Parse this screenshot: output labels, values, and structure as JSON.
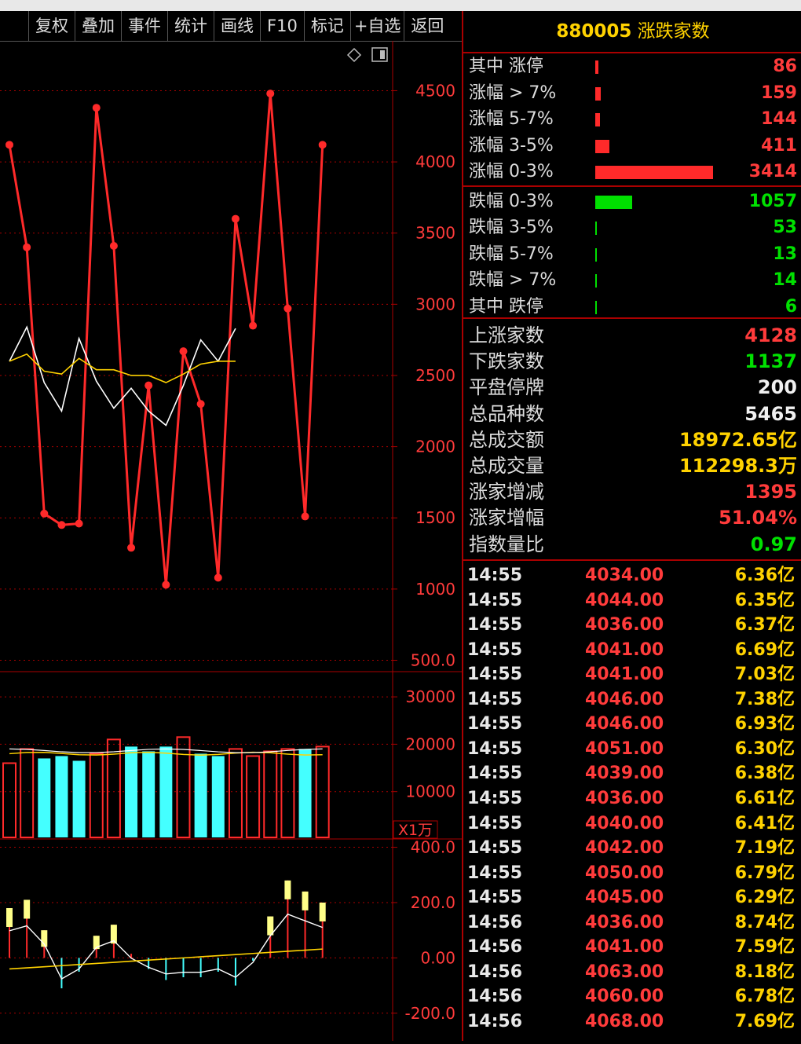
{
  "toolbar": {
    "buttons": [
      "复权",
      "叠加",
      "事件",
      "统计",
      "画线",
      "F10",
      "标记",
      "+自选",
      "返回"
    ]
  },
  "panel": {
    "code": "880005",
    "name": "涨跌家数",
    "breadth": [
      {
        "label": "其中 涨停",
        "value": "86",
        "kind": "up",
        "fraction": 0.025
      },
      {
        "label": "涨幅 > 7%",
        "value": "159",
        "kind": "up",
        "fraction": 0.046
      },
      {
        "label": "涨幅 5-7%",
        "value": "144",
        "kind": "up",
        "fraction": 0.042
      },
      {
        "label": "涨幅 3-5%",
        "value": "411",
        "kind": "up",
        "fraction": 0.12
      },
      {
        "label": "涨幅 0-3%",
        "value": "3414",
        "kind": "up",
        "fraction": 1.0
      },
      {
        "label": "跌幅 0-3%",
        "value": "1057",
        "kind": "down",
        "fraction": 0.31
      },
      {
        "label": "跌幅 3-5%",
        "value": "53",
        "kind": "down",
        "fraction": 0.015
      },
      {
        "label": "跌幅 5-7%",
        "value": "13",
        "kind": "down",
        "fraction": 0.01
      },
      {
        "label": "跌幅 > 7%",
        "value": "14",
        "kind": "down",
        "fraction": 0.01
      },
      {
        "label": "其中 跌停",
        "value": "6",
        "kind": "down",
        "fraction": 0.01
      }
    ],
    "stats": [
      {
        "label": "上涨家数",
        "value": "4128",
        "color": "#ff3b3b"
      },
      {
        "label": "下跌家数",
        "value": "1137",
        "color": "#00e000"
      },
      {
        "label": "平盘停牌",
        "value": "200",
        "color": "#f0f0f0"
      },
      {
        "label": "总品种数",
        "value": "5465",
        "color": "#f0f0f0"
      },
      {
        "label": "总成交额",
        "value": "18972.65亿",
        "color": "#ffd200"
      },
      {
        "label": "总成交量",
        "value": "112298.3万",
        "color": "#ffd200"
      },
      {
        "label": "涨家增减",
        "value": "1395",
        "color": "#ff3b3b"
      },
      {
        "label": "涨家增幅",
        "value": "51.04%",
        "color": "#ff3b3b"
      },
      {
        "label": "指数量比",
        "value": "0.97",
        "color": "#00e000"
      }
    ],
    "ticks": [
      {
        "time": "14:55",
        "price": "4034.00",
        "amount": "6.36亿"
      },
      {
        "time": "14:55",
        "price": "4044.00",
        "amount": "6.35亿"
      },
      {
        "time": "14:55",
        "price": "4036.00",
        "amount": "6.37亿"
      },
      {
        "time": "14:55",
        "price": "4041.00",
        "amount": "6.69亿"
      },
      {
        "time": "14:55",
        "price": "4041.00",
        "amount": "7.03亿"
      },
      {
        "time": "14:55",
        "price": "4046.00",
        "amount": "7.38亿"
      },
      {
        "time": "14:55",
        "price": "4046.00",
        "amount": "6.93亿"
      },
      {
        "time": "14:55",
        "price": "4051.00",
        "amount": "6.30亿"
      },
      {
        "time": "14:55",
        "price": "4039.00",
        "amount": "6.38亿"
      },
      {
        "time": "14:55",
        "price": "4036.00",
        "amount": "6.61亿"
      },
      {
        "time": "14:55",
        "price": "4040.00",
        "amount": "6.41亿"
      },
      {
        "time": "14:55",
        "price": "4042.00",
        "amount": "7.19亿"
      },
      {
        "time": "14:55",
        "price": "4050.00",
        "amount": "6.79亿"
      },
      {
        "time": "14:55",
        "price": "4045.00",
        "amount": "6.29亿"
      },
      {
        "time": "14:56",
        "price": "4036.00",
        "amount": "8.74亿"
      },
      {
        "time": "14:56",
        "price": "4041.00",
        "amount": "7.59亿"
      },
      {
        "time": "14:56",
        "price": "4063.00",
        "amount": "8.18亿"
      },
      {
        "time": "14:56",
        "price": "4060.00",
        "amount": "6.78亿"
      },
      {
        "time": "14:56",
        "price": "4068.00",
        "amount": "7.69亿"
      }
    ]
  },
  "chart_data": [
    {
      "type": "line",
      "panel": "main",
      "yticks": [
        "4500",
        "4000",
        "3500",
        "3000",
        "2500",
        "2000",
        "1500",
        "1000",
        "500.0"
      ],
      "ylim": [
        420,
        4850
      ],
      "series": [
        {
          "color": "#ff2a2a",
          "markers": true,
          "values": [
            4120,
            3400,
            1530,
            1450,
            1460,
            4380,
            3410,
            1290,
            2430,
            1030,
            2670,
            2300,
            1080,
            3600,
            2850,
            4480,
            2970,
            1510,
            4120
          ]
        },
        {
          "color": "#ffffff",
          "markers": false,
          "values": [
            2600,
            2840,
            2450,
            2250,
            2760,
            2460,
            2270,
            2410,
            2250,
            2150,
            2430,
            2750,
            2600,
            2830
          ]
        },
        {
          "color": "#ffd200",
          "markers": false,
          "values": [
            2600,
            2650,
            2530,
            2510,
            2620,
            2540,
            2540,
            2500,
            2500,
            2450,
            2510,
            2580,
            2600,
            2600
          ]
        }
      ]
    },
    {
      "type": "bar",
      "panel": "volume",
      "unit": "X1万",
      "yticks": [
        "30000",
        "20000",
        "10000"
      ],
      "ylim": [
        0,
        32000
      ],
      "values": [
        16000,
        19000,
        17000,
        17500,
        16500,
        18000,
        21000,
        19500,
        18500,
        19500,
        21500,
        18000,
        17500,
        19000,
        17500,
        18500,
        19000,
        19000,
        19500
      ],
      "up": [
        true,
        true,
        false,
        false,
        false,
        true,
        true,
        false,
        false,
        false,
        true,
        false,
        false,
        true,
        true,
        true,
        true,
        false,
        true
      ]
    },
    {
      "type": "bar",
      "panel": "macd",
      "yticks": [
        "400.0",
        "200.0",
        "0.00",
        "-200.0"
      ],
      "ylim": [
        -300,
        430
      ],
      "values": [
        180,
        210,
        100,
        -110,
        -50,
        80,
        120,
        15,
        -40,
        -80,
        -70,
        -70,
        -50,
        -100,
        -10,
        150,
        280,
        240,
        200
      ]
    }
  ]
}
